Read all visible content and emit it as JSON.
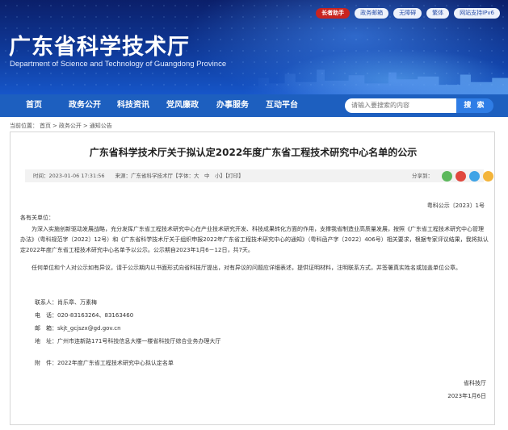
{
  "header": {
    "title": "广东省科学技术厅",
    "subtitle": "Department of Science and Technology of Guangdong Province",
    "top_links": [
      "长者助手",
      "政务邮箱",
      "无障碍",
      "繁体",
      "网站支持IPv6"
    ]
  },
  "nav": {
    "items": [
      "首页",
      "政务公开",
      "科技资讯",
      "党风廉政",
      "办事服务",
      "互动平台"
    ],
    "search_placeholder": "请输入要搜索的内容",
    "search_button": "搜 索"
  },
  "breadcrumb": {
    "prefix": "当前位置：",
    "items": [
      "首页",
      "政务公开",
      "通知公告"
    ],
    "separator": ">"
  },
  "article": {
    "title": "广东省科学技术厅关于拟认定2022年度广东省工程技术研究中心名单的公示",
    "meta": "时间：2023-01-06 17:31:56　　来源：广东省科学技术厅【字体：大　中　小】【打印】",
    "share_label": "分享到：",
    "share_icons": [
      "wechat-icon",
      "weibo-icon",
      "qq-icon",
      "qzone-icon"
    ],
    "doc_number": "粤科公示〔2023〕1号",
    "salutation": "各有关单位：",
    "paragraph1": "为深入实施创新驱动发展战略，充分发挥广东省工程技术研究中心在产业技术研究开发、科技成果转化方面的作用，支撑我省制造业高质量发展，按照《广东省工程技术研究中心管理办法》（粤科规范字〔2022〕12号）和《广东省科学技术厅关于组织申报2022年广东省工程技术研究中心的通知》（粤科函产字〔2022〕406号）相关要求，根据专家评议结果，我将拟认定2022年度广东省工程技术研究中心名单予以公示。公示期自2023年1月6－12日，共7天。",
    "paragraph2": "任何单位和个人对公示如有异议，请于公示期内以书面形式向省科技厅提出，对有异议的问题应详细表述，提供证明材料，注明联系方式，并签署真实姓名或加盖单位公章。",
    "contacts": [
      {
        "label": "联系人：",
        "value": "肖乐章、万素梅"
      },
      {
        "label": "电　话：",
        "value": "020-83163264、83163460"
      },
      {
        "label": "邮　箱：",
        "value": "skjt_gcjszx@gd.gov.cn"
      },
      {
        "label": "地　址：",
        "value": "广州市连新路171号科技信息大楼一楼省科技厅综合业务办理大厅"
      }
    ],
    "attachment": "附　件：2022年度广东省工程技术研究中心拟认定名单",
    "signature_org": "省科技厅",
    "signature_date": "2023年1月6日"
  },
  "colors": {
    "nav_bg": "#1d5fbf",
    "elder_badge": "#c9241f",
    "share_wechat": "#5cb85c",
    "share_weibo": "#e0483e",
    "share_qq": "#3fa3e6",
    "share_qzone": "#f3b43a"
  }
}
